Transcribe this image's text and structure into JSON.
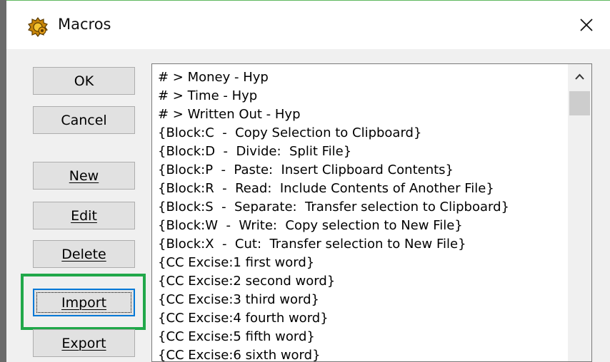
{
  "window": {
    "title": "Macros",
    "accent_color": "#0078d7",
    "highlight_color": "#21a84a"
  },
  "buttons": {
    "ok": "OK",
    "cancel": "Cancel",
    "new": "New",
    "edit": "Edit",
    "delete": "Delete",
    "import": "Import",
    "export": "Export"
  },
  "macros": [
    "# > Money - Hyp",
    "# > Time - Hyp",
    "# > Written Out - Hyp",
    "{Block:C  -  Copy Selection to Clipboard}",
    "{Block:D  -  Divide:  Split File}",
    "{Block:P  -  Paste:  Insert Clipboard Contents}",
    "{Block:R  -  Read:  Include Contents of Another File}",
    "{Block:S  -  Separate:  Transfer selection to Clipboard}",
    "{Block:W  -  Write:  Copy selection to New File}",
    "{Block:X  -  Cut:  Transfer selection to New File}",
    "{CC Excise:1 first word}",
    "{CC Excise:2 second word}",
    "{CC Excise:3 third word}",
    "{CC Excise:4 fourth word}",
    "{CC Excise:5 fifth word}",
    "{CC Excise:6 sixth word}"
  ],
  "icons": {
    "app": "macro-app-icon",
    "close": "close-icon",
    "scroll_up": "chevron-up-icon"
  }
}
